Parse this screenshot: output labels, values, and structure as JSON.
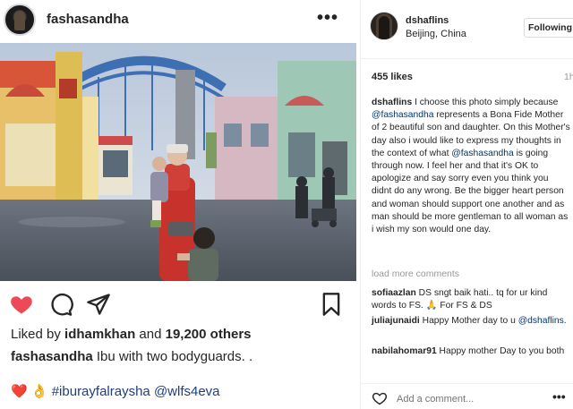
{
  "left_post": {
    "username": "fashasandha",
    "more_icon": "•••",
    "liked_by_prefix": "Liked by ",
    "liked_by_user": "idhamkhan",
    "liked_by_suffix": " and ",
    "liked_by_others": "19,200 others",
    "caption_user": "fashasandha",
    "caption_text": " Ibu with two bodyguards. .",
    "caption_trailing": ".",
    "tags_emojis": "❤️ 👌",
    "hashtag": "#iburayfalraysha",
    "mention": "@wlfs4eva",
    "icons": [
      "heart-filled-icon",
      "comment-icon",
      "share-icon",
      "bookmark-icon"
    ],
    "like_color": "#ed4956"
  },
  "right_post": {
    "username": "dshaflins",
    "location": "Beijing, China",
    "follow_label": "Following",
    "likes": "455 likes",
    "time": "1h",
    "caption_user": "dshaflins",
    "caption_parts": [
      {
        "t": " I choose this photo simply because ",
        "m": false
      },
      {
        "t": "@fashasandha",
        "m": true
      },
      {
        "t": " represents a Bona Fide Mother of 2 beautiful son and daughter. On this Mother's day also i would like to express my thoughts in the context of what ",
        "m": false
      },
      {
        "t": "@fashasandha",
        "m": true
      },
      {
        "t": " is going through now. I feel her and that it's OK to apologize and say sorry even you think you didnt do any wrong. Be the bigger heart person and woman should support one another and as man should be more gentleman to all woman as i wish my son would one day.",
        "m": false
      }
    ],
    "load_more": "load more comments",
    "comments": [
      {
        "user": "sofiaazlan",
        "text": " DS sngt baik hati.. tq for ur kind words to FS. 🙏 For FS & DS"
      },
      {
        "user": "juliajunaidi",
        "text": " Happy Mother day to u ",
        "mention": "@dshaflins",
        "after": "."
      },
      {
        "user": "nabilahomar91",
        "text": " Happy mother Day to you both"
      }
    ],
    "add_comment_placeholder": "Add a comment...",
    "options_icon": "•••",
    "accent_link": "#003569"
  }
}
